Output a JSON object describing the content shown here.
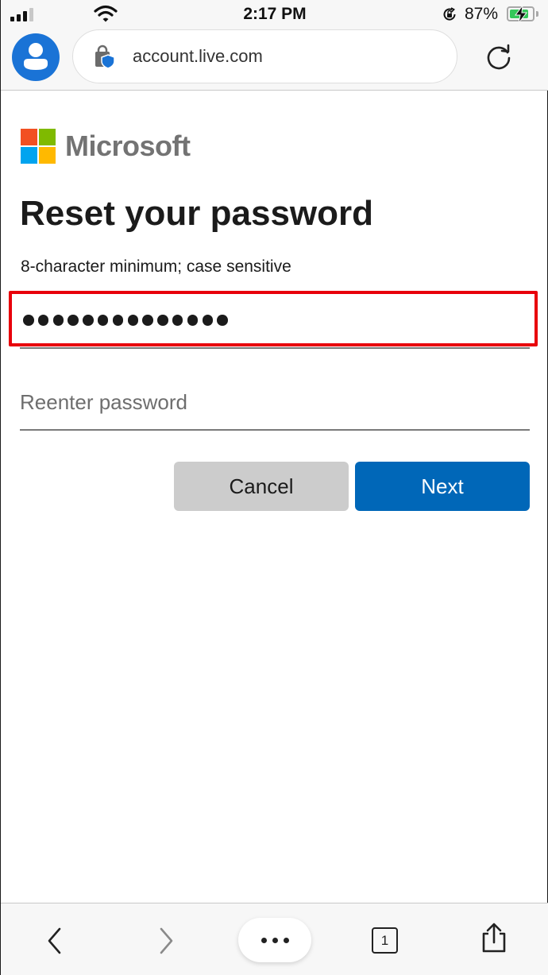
{
  "status_bar": {
    "time": "2:17 PM",
    "battery_percent": "87%",
    "battery_level": 0.87,
    "signal_bars_active": 3,
    "signal_bars_total": 4,
    "charging": true,
    "orientation_lock": true
  },
  "browser": {
    "url": "account.live.com",
    "tabs_count": "1"
  },
  "page": {
    "brand": "Microsoft",
    "brand_colors": [
      "#f25022",
      "#7fba00",
      "#00a4ef",
      "#ffb900"
    ],
    "title": "Reset your password",
    "hint": "8-character minimum; case sensitive",
    "password": {
      "masked_length": 14,
      "highlight_color": "#e8000b"
    },
    "reenter": {
      "placeholder": "Reenter password",
      "value": ""
    },
    "buttons": {
      "cancel": "Cancel",
      "next": "Next"
    },
    "accent_color": "#0067b8"
  }
}
